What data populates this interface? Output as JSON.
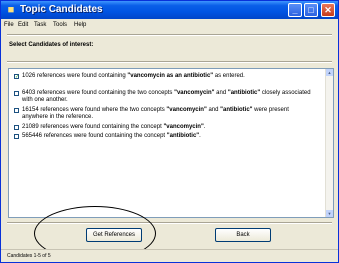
{
  "window": {
    "title": "Topic Candidates",
    "title_icon": "folder-icon"
  },
  "menu": [
    "File",
    "Edit",
    "Task",
    "Tools",
    "Help"
  ],
  "instruction": "Select Candidates of interest:",
  "options": [
    {
      "checked": true,
      "before": "1026 references were found containing ",
      "bold1": "\"vancomycin as an antibiotic\"",
      "middle": " as entered.",
      "bold2": "",
      "after": ""
    },
    {
      "checked": false,
      "before": "6403 references were found containing the two concepts ",
      "bold1": "\"vancomycin\"",
      "middle": " and ",
      "bold2": "\"antibiotic\"",
      "after": " closely associated with one another."
    },
    {
      "checked": false,
      "before": "16154 references were found where the two concepts ",
      "bold1": "\"vancomycin\"",
      "middle": " and ",
      "bold2": "\"antibiotic\"",
      "after": " were present anywhere in the reference."
    },
    {
      "checked": false,
      "before": "21089 references were found containing the concept ",
      "bold1": "\"vancomycin\"",
      "middle": ".",
      "bold2": "",
      "after": ""
    },
    {
      "checked": false,
      "before": "565446 references were found containing the concept ",
      "bold1": "\"antibiotic\"",
      "middle": ".",
      "bold2": "",
      "after": ""
    }
  ],
  "buttons": {
    "get_references": "Get References",
    "back": "Back"
  },
  "status": "Candidates 1-5 of 5",
  "colors": {
    "titlebar": "#0054e3",
    "window_bg": "#ece9d8",
    "check_mark": "#21a121"
  }
}
